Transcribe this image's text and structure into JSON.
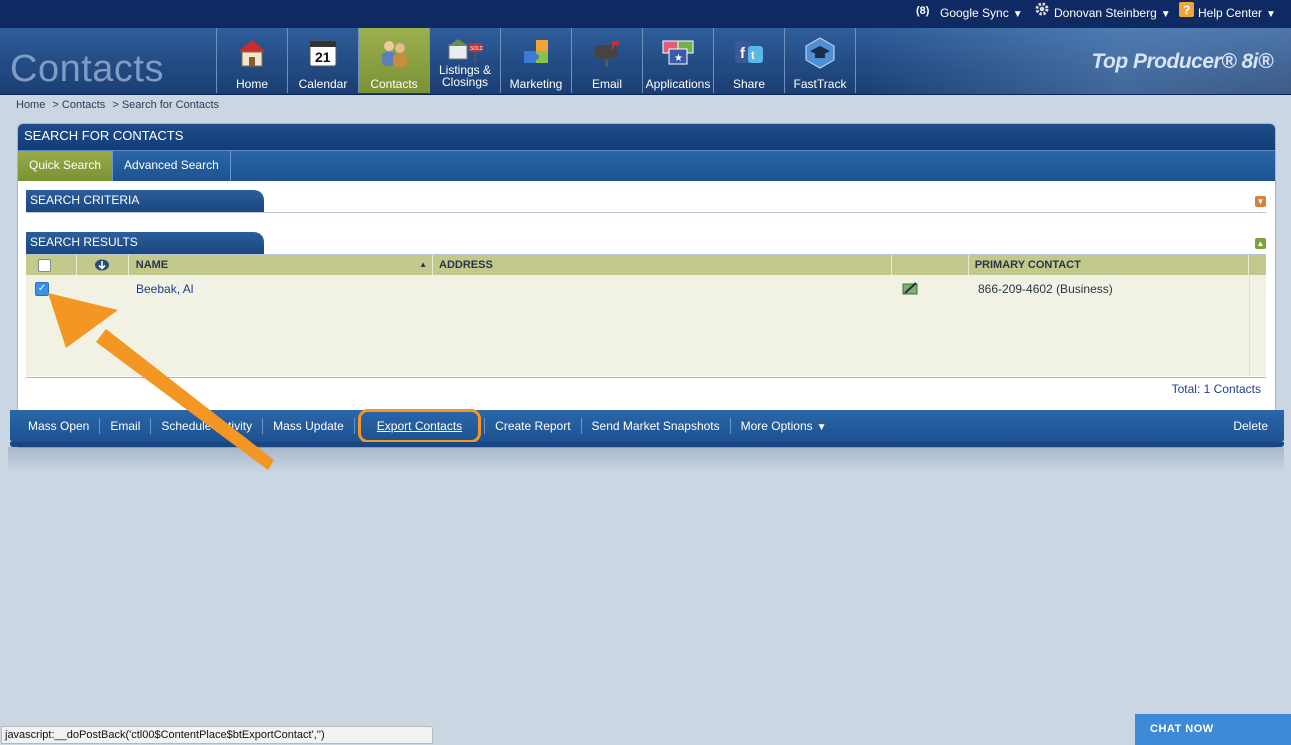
{
  "topbar": {
    "google_sync": "Google Sync",
    "user": "Donovan Steinberg",
    "help": "Help Center"
  },
  "header": {
    "app_title": "Contacts",
    "brand": "Top Producer® 8i®",
    "nav": [
      {
        "label": "Home",
        "icon": "house-icon"
      },
      {
        "label": "Calendar",
        "icon": "calendar-icon",
        "icon_text": "21"
      },
      {
        "label": "Contacts",
        "icon": "people-icon",
        "active": true
      },
      {
        "label_line1": "Listings &",
        "label_line2": "Closings",
        "icon": "listing-sign-icon"
      },
      {
        "label": "Marketing",
        "icon": "puzzle-icon"
      },
      {
        "label": "Email",
        "icon": "mailbox-icon"
      },
      {
        "label": "Applications",
        "icon": "apps-icon"
      },
      {
        "label": "Share",
        "icon": "social-share-icon"
      },
      {
        "label": "FastTrack",
        "icon": "graduation-cap-icon"
      }
    ]
  },
  "breadcrumb": [
    "Home",
    "> Contacts",
    "> Search for Contacts"
  ],
  "panel": {
    "title": "SEARCH FOR CONTACTS",
    "tabs": {
      "quick": "Quick Search",
      "advanced": "Advanced Search"
    },
    "criteria_title": "SEARCH CRITERIA",
    "results_title": "SEARCH RESULTS"
  },
  "table": {
    "headers": {
      "name": "NAME",
      "address": "ADDRESS",
      "primary": "PRIMARY CONTACT"
    },
    "rows": [
      {
        "name": "Beebak, Al",
        "address": "",
        "primary_contact": "866-209-4602 (Business)",
        "checked": true
      }
    ],
    "total": "Total: 1 Contacts"
  },
  "actions": {
    "mass_open": "Mass Open",
    "email": "Email",
    "schedule": "Schedule Activity",
    "mass_update": "Mass Update",
    "export": "Export Contacts",
    "report": "Create Report",
    "snapshots": "Send Market Snapshots",
    "more": "More Options",
    "delete": "Delete"
  },
  "status_bar": "javascript:__doPostBack('ctl00$ContentPlace$btExportContact','')",
  "chat": "CHAT NOW",
  "colors": {
    "accent_highlight": "#f39623",
    "active_tab": "#8aa23f",
    "navy": "#0f2a63"
  }
}
